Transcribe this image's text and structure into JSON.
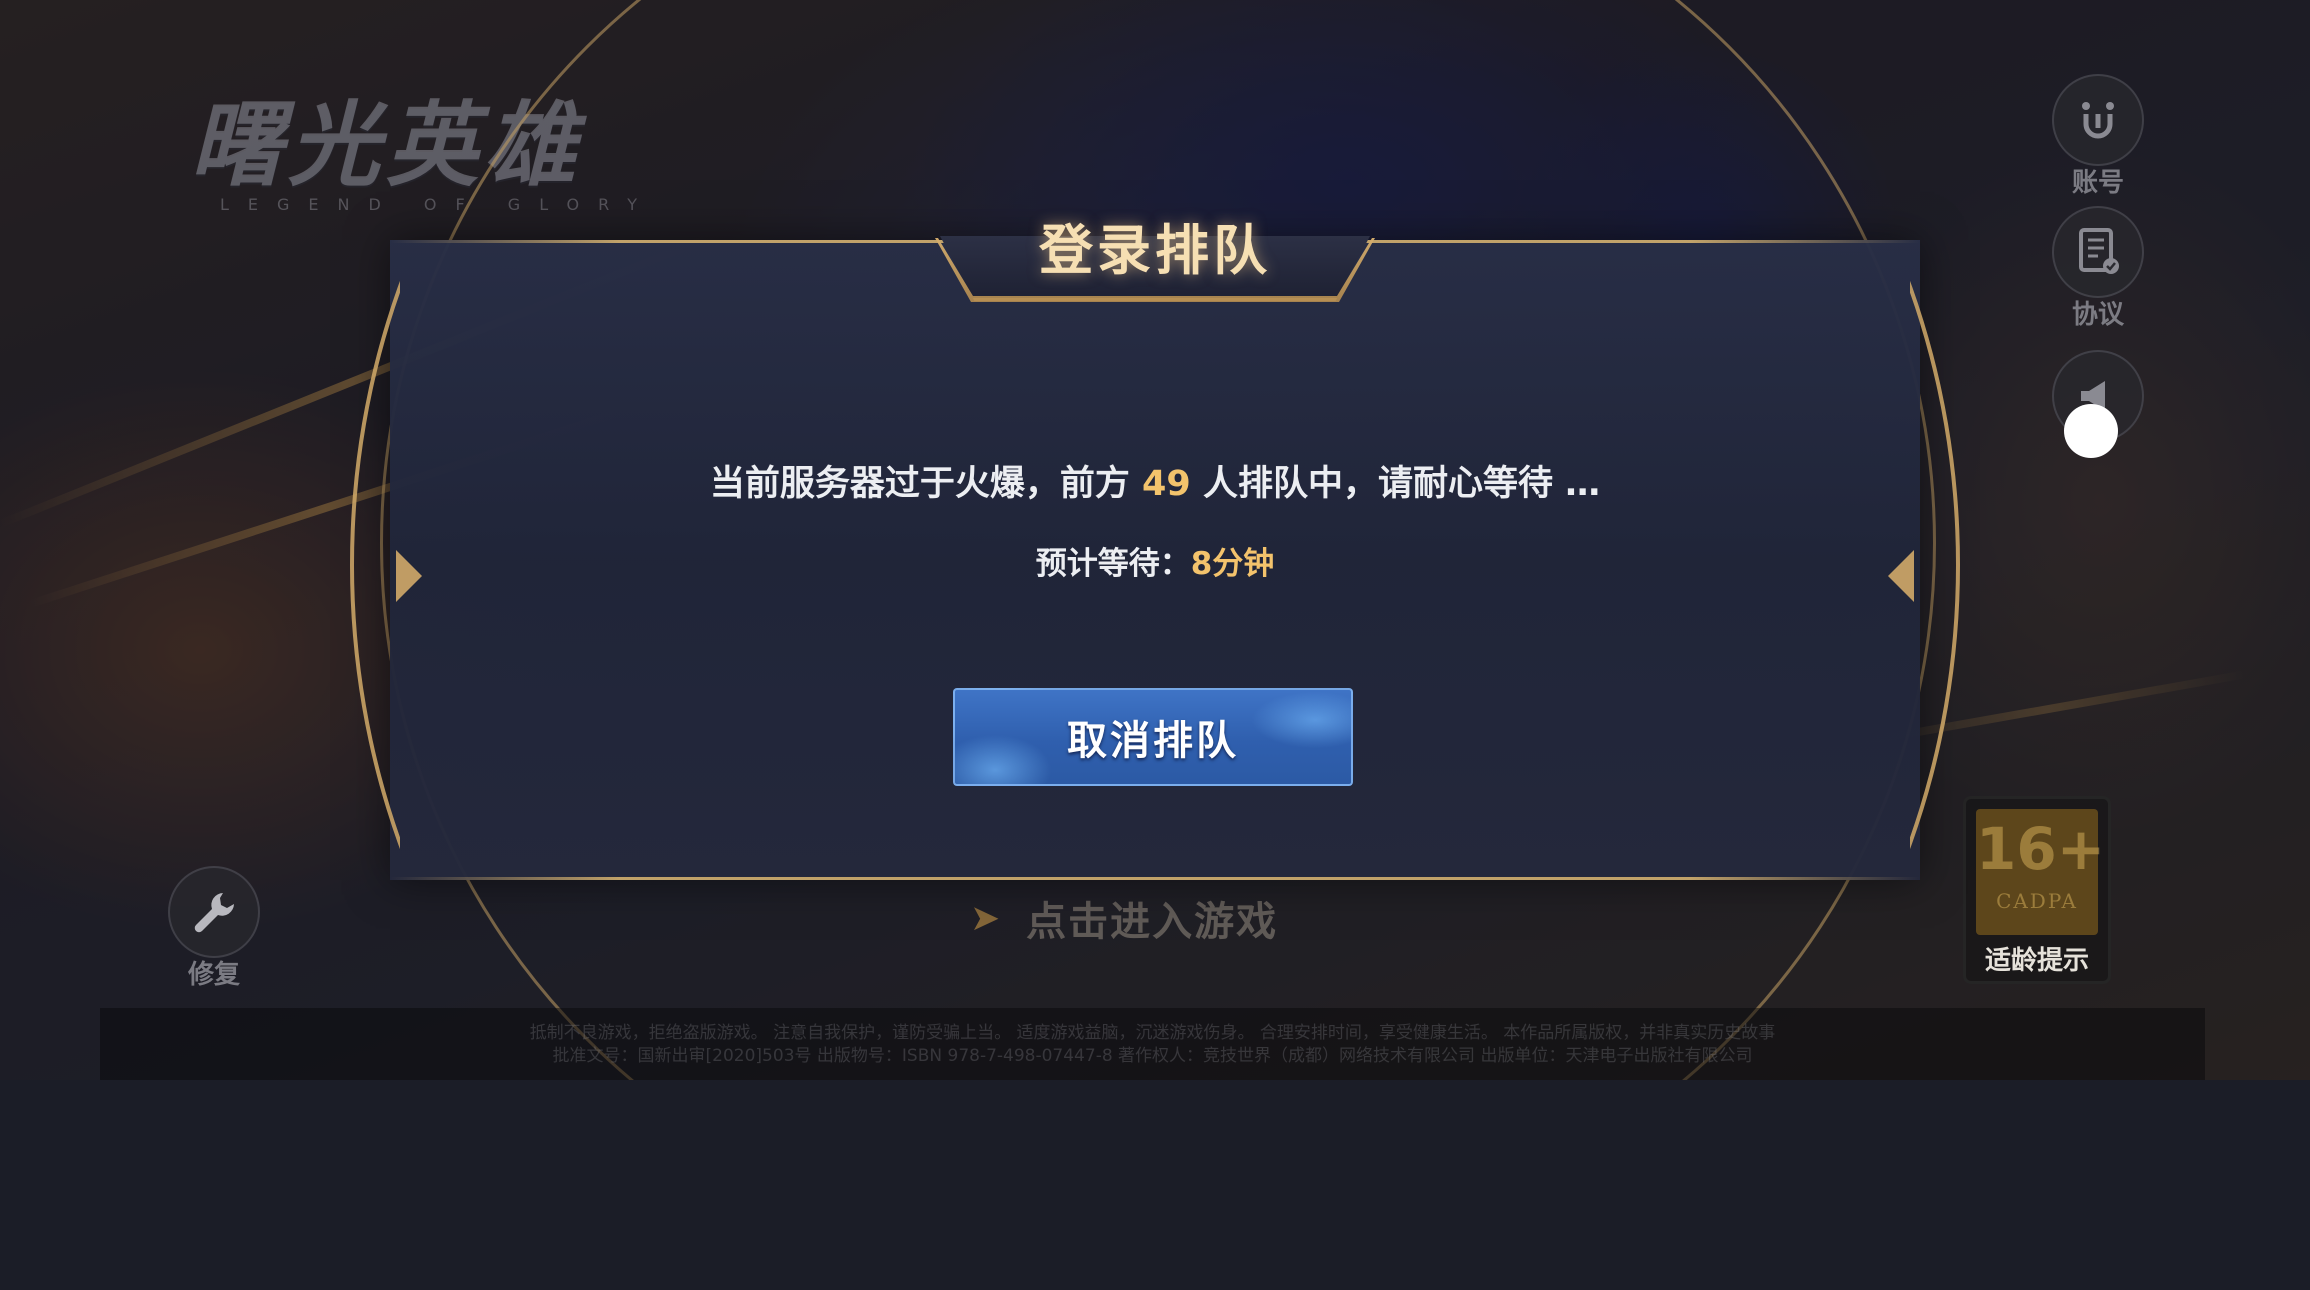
{
  "logo": {
    "title": "曙光英雄",
    "subtitle": "LEGEND OF GLORY"
  },
  "side_buttons": {
    "account_label": "账号",
    "agreement_label": "协议",
    "repair_label": "修复"
  },
  "enter_game": {
    "label": "点击进入游戏"
  },
  "age_rating": {
    "number": "16+",
    "org": "CADPA",
    "label": "适龄提示"
  },
  "footer": {
    "line1": "抵制不良游戏，拒绝盗版游戏。 注意自我保护，谨防受骗上当。 适度游戏益脑，沉迷游戏伤身。 合理安排时间，享受健康生活。 本作品所属版权，并非真实历史故事",
    "line2": "批准文号：国新出审[2020]503号 出版物号：ISBN 978-7-498-07447-8 著作权人：竞技世界（成都）网络技术有限公司 出版单位：天津电子出版社有限公司"
  },
  "dialog": {
    "title": "登录排队",
    "message_prefix": "当前服务器过于火爆，前方",
    "queue_count": "49",
    "message_suffix": "人排队中，请耐心等待 …",
    "wait_label": "预计等待：",
    "wait_time": "8分钟",
    "cancel_label": "取消排队"
  },
  "colors": {
    "highlight": "#f3c36c",
    "gold_border": "#d2aa69",
    "button_blue": "#2f5fae",
    "dialog_bg": "#20253a"
  }
}
